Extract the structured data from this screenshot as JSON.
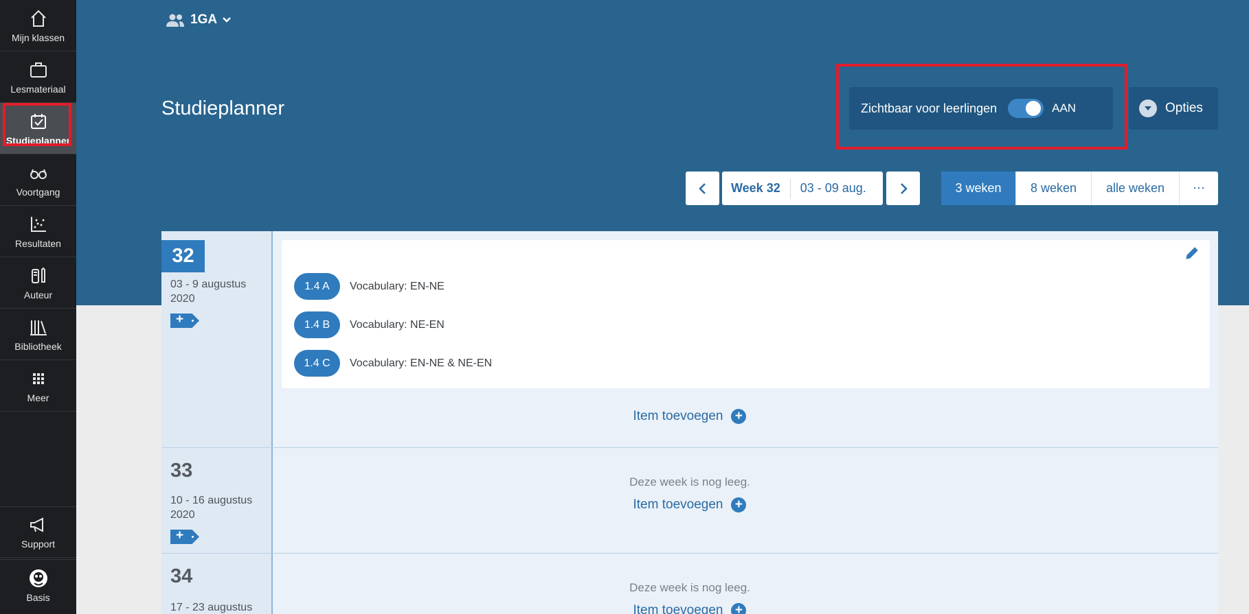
{
  "sidebar": {
    "items": [
      {
        "label": "Mijn klassen",
        "icon": "home-icon"
      },
      {
        "label": "Lesmateriaal",
        "icon": "briefcase-icon"
      },
      {
        "label": "Studieplanner",
        "icon": "calendar-check-icon",
        "active": true
      },
      {
        "label": "Voortgang",
        "icon": "glasses-icon"
      },
      {
        "label": "Resultaten",
        "icon": "scatter-chart-icon"
      },
      {
        "label": "Auteur",
        "icon": "author-icon"
      },
      {
        "label": "Bibliotheek",
        "icon": "books-icon"
      },
      {
        "label": "Meer",
        "icon": "grid-icon"
      }
    ],
    "support_label": "Support",
    "profile_label": "Basis"
  },
  "header": {
    "class_name": "1GA",
    "title": "Studieplanner",
    "visibility_label": "Zichtbaar voor leerlingen",
    "toggle_state": "AAN",
    "options_label": "Opties"
  },
  "nav": {
    "week_label": "Week 32",
    "week_range": "03 - 09 aug.",
    "ranges": [
      "3 weken",
      "8 weken",
      "alle weken",
      "⋯"
    ],
    "active_range": "3 weken"
  },
  "weeks": [
    {
      "number": "32",
      "dates": "03 - 9 augustus 2020",
      "items": [
        {
          "badge": "1.4 A",
          "text": "Vocabulary: EN-NE"
        },
        {
          "badge": "1.4 B",
          "text": "Vocabulary: NE-EN"
        },
        {
          "badge": "1.4 C",
          "text": "Vocabulary: EN-NE & NE-EN"
        }
      ],
      "add_label": "Item toevoegen"
    },
    {
      "number": "33",
      "dates": "10 - 16 augustus 2020",
      "empty_label": "Deze week is nog leeg.",
      "add_label": "Item toevoegen"
    },
    {
      "number": "34",
      "dates": "17 - 23 augustus",
      "empty_label": "Deze week is nog leeg.",
      "add_label": "Item toevoegen"
    }
  ],
  "colors": {
    "sidebar_bg": "#1c1e21",
    "header_bg": "#29648f",
    "accent": "#2f7bbd",
    "highlight": "#e11d2c"
  }
}
